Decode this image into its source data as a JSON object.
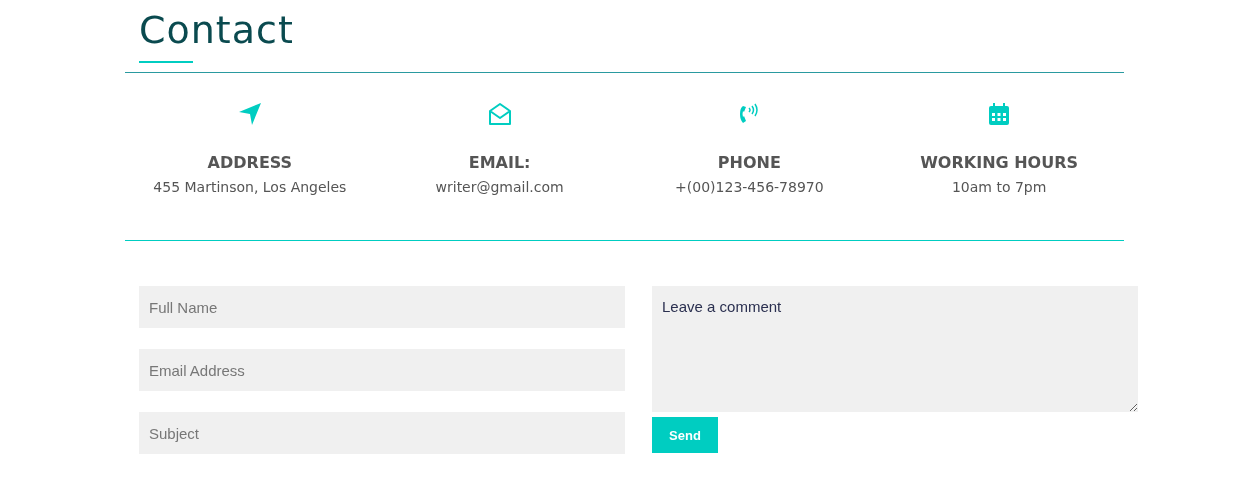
{
  "title": "Contact",
  "info": [
    {
      "heading": "ADDRESS",
      "value": "455 Martinson, Los Angeles"
    },
    {
      "heading": "EMAIL:",
      "value": "writer@gmail.com"
    },
    {
      "heading": "PHONE",
      "value": "+(00)123-456-78970"
    },
    {
      "heading": "WORKING HOURS",
      "value": "10am to 7pm"
    }
  ],
  "form": {
    "fields": [
      {
        "placeholder": "Full Name"
      },
      {
        "placeholder": "Email Address"
      },
      {
        "placeholder": "Subject"
      }
    ],
    "comment": {
      "value": "Leave a comment"
    },
    "button": "Send"
  }
}
